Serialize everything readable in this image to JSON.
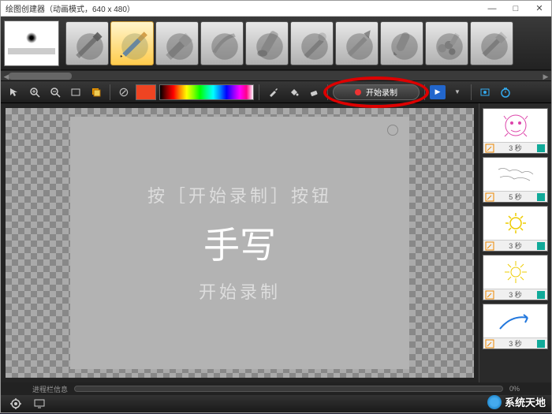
{
  "window": {
    "title": "绘图创建器（动画模式，640 x 480）",
    "minimize": "—",
    "maximize": "□",
    "close": "✕"
  },
  "brushes": {
    "count": 10,
    "selected_index": 1
  },
  "toolbar": {
    "no_color": "⊘",
    "swatch_color": "#ee4422",
    "record_label": "开始录制",
    "play": "▶"
  },
  "canvas": {
    "hint1": "按［开始录制］按钮",
    "big": "手写",
    "hint2": "开始录制"
  },
  "thumbnails": [
    {
      "duration": "3 秒",
      "type": "face"
    },
    {
      "duration": "5 秒",
      "type": "map"
    },
    {
      "duration": "3 秒",
      "type": "sun"
    },
    {
      "duration": "3 秒",
      "type": "sun2"
    },
    {
      "duration": "3 秒",
      "type": "arrow"
    }
  ],
  "progress": {
    "label": "进程栏信息",
    "percent": "0%"
  },
  "watermark": "系统天地"
}
